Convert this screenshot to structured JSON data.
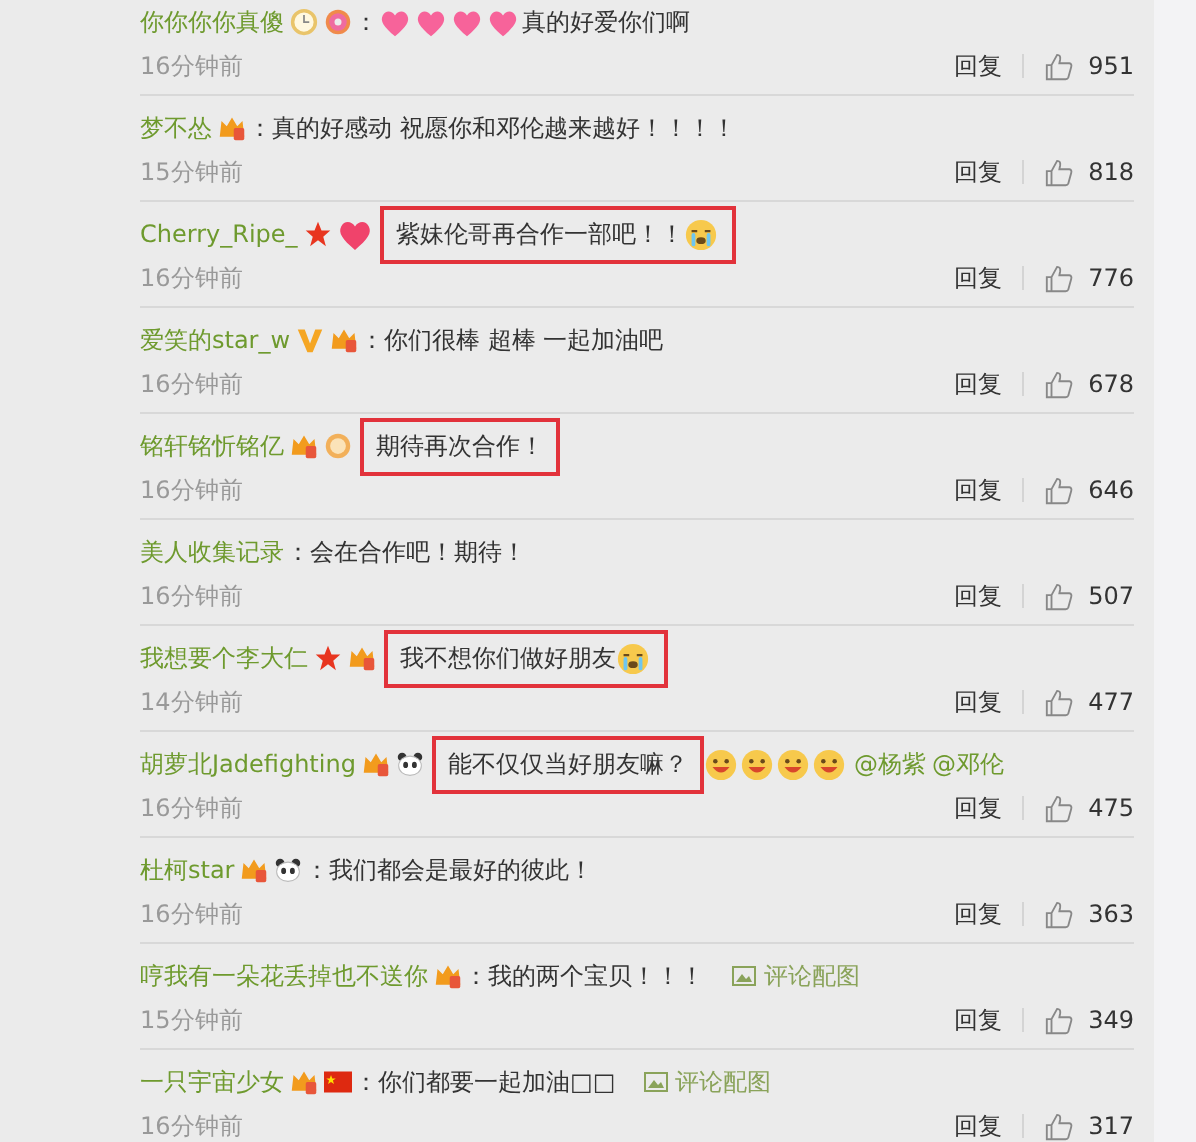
{
  "comments": [
    {
      "name": "你你你你真傻",
      "icons": [
        {
          "kind": "clock"
        },
        {
          "kind": "donut"
        }
      ],
      "separator": "：",
      "parts": [
        {
          "kind": "heart"
        },
        {
          "kind": "heart"
        },
        {
          "kind": "heart"
        },
        {
          "kind": "heart"
        },
        {
          "kind": "text",
          "text": "真的好爱你们啊"
        }
      ],
      "time": "16分钟前",
      "reply": "回复",
      "likes": "951"
    },
    {
      "name": "梦不怂",
      "icons": [
        {
          "kind": "crown"
        }
      ],
      "separator": "：",
      "parts": [
        {
          "kind": "text",
          "text": "真的好感动 祝愿你和邓伦越来越好！！！！"
        }
      ],
      "time": "15分钟前",
      "reply": "回复",
      "likes": "818"
    },
    {
      "name": "Cherry_Ripe_",
      "icons": [
        {
          "kind": "star"
        },
        {
          "kind": "heart"
        }
      ],
      "highlight_parts": [
        {
          "kind": "text",
          "text": "紫妹伦哥再合作一部吧！！"
        },
        {
          "kind": "crying"
        }
      ],
      "time": "16分钟前",
      "reply": "回复",
      "likes": "776"
    },
    {
      "name": "爱笑的star_w",
      "icons": [
        {
          "kind": "v"
        },
        {
          "kind": "crown"
        }
      ],
      "separator": "：",
      "parts": [
        {
          "kind": "text",
          "text": "你们很棒 超棒 一起加油吧"
        }
      ],
      "time": "16分钟前",
      "reply": "回复",
      "likes": "678"
    },
    {
      "name": "铭轩铭忻铭亿",
      "icons": [
        {
          "kind": "crown"
        },
        {
          "kind": "medal"
        }
      ],
      "highlight_parts": [
        {
          "kind": "text",
          "text": "期待再次合作！"
        }
      ],
      "time": "16分钟前",
      "reply": "回复",
      "likes": "646"
    },
    {
      "name": "美人收集记录",
      "separator": "：",
      "parts": [
        {
          "kind": "text",
          "text": "会在合作吧！期待！"
        }
      ],
      "time": "16分钟前",
      "reply": "回复",
      "likes": "507"
    },
    {
      "name": "我想要个李大仁",
      "icons": [
        {
          "kind": "star"
        },
        {
          "kind": "crown"
        }
      ],
      "highlight_parts": [
        {
          "kind": "text",
          "text": "我不想你们做好朋友"
        },
        {
          "kind": "crying"
        }
      ],
      "time": "14分钟前",
      "reply": "回复",
      "likes": "477"
    },
    {
      "name": "胡萝北Jadefighting",
      "icons": [
        {
          "kind": "crown"
        },
        {
          "kind": "panda"
        }
      ],
      "highlight_parts": [
        {
          "kind": "text",
          "text": "能不仅仅当好朋友嘛？"
        }
      ],
      "parts": [
        {
          "kind": "grin"
        },
        {
          "kind": "grin"
        },
        {
          "kind": "grin"
        },
        {
          "kind": "grin"
        },
        {
          "kind": "mention",
          "text": "@杨紫"
        },
        {
          "kind": "mention",
          "text": "@邓伦"
        }
      ],
      "time": "16分钟前",
      "reply": "回复",
      "likes": "475"
    },
    {
      "name": "杜柯star",
      "icons": [
        {
          "kind": "crown"
        },
        {
          "kind": "panda"
        }
      ],
      "separator": "：",
      "parts": [
        {
          "kind": "text",
          "text": "我们都会是最好的彼此！"
        }
      ],
      "time": "16分钟前",
      "reply": "回复",
      "likes": "363"
    },
    {
      "name": "哼我有一朵花丢掉也不送你",
      "icons": [
        {
          "kind": "crown"
        }
      ],
      "separator": "：",
      "parts": [
        {
          "kind": "text",
          "text": "我的两个宝贝！！！"
        },
        {
          "kind": "image-link",
          "text": "评论配图"
        }
      ],
      "time": "15分钟前",
      "reply": "回复",
      "likes": "349"
    },
    {
      "name": "一只宇宙少女",
      "icons": [
        {
          "kind": "crown"
        },
        {
          "kind": "flag"
        }
      ],
      "separator": "：",
      "parts": [
        {
          "kind": "text",
          "text": "你们都要一起加油□□"
        },
        {
          "kind": "image-link",
          "text": "评论配图"
        }
      ],
      "time": "16分钟前",
      "reply": "回复",
      "likes": "317"
    }
  ]
}
